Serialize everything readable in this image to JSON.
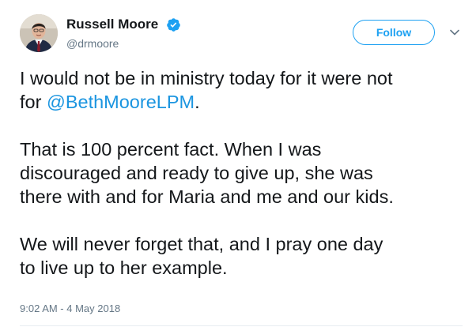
{
  "author": {
    "name": "Russell Moore",
    "handle": "@drmoore"
  },
  "follow_label": "Follow",
  "tweet": {
    "p1_line1": "I would not be in ministry today for it were not",
    "p1_line2_prefix": "for ",
    "p1_mention": "@BethMooreLPM",
    "p1_line2_suffix": ".",
    "p2_line1": "That is 100 percent fact. When I was",
    "p2_line2": "discouraged and ready to give up, she was",
    "p2_line3": "there with and for Maria and me and our kids.",
    "p3_line1": "We will never forget that, and I pray one day",
    "p3_line2": "to live up to her example."
  },
  "timestamp": "9:02 AM - 4 May 2018",
  "icons": {
    "verified": "verified-badge-icon",
    "caret": "chevron-down-icon"
  },
  "colors": {
    "accent": "#1da1f2",
    "mention": "#1b95e0",
    "secondary_text": "#657786",
    "primary_text": "#14171a"
  }
}
